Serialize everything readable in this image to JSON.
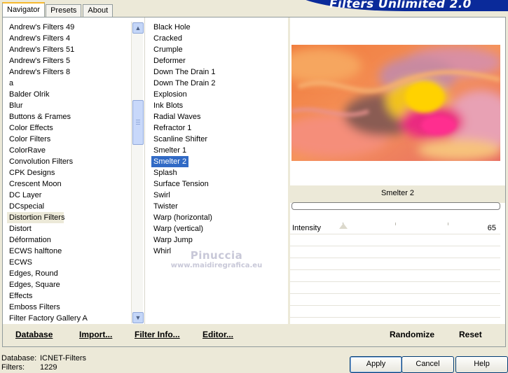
{
  "header": {
    "tabs": [
      {
        "label": "Navigator"
      },
      {
        "label": "Presets"
      },
      {
        "label": "About"
      }
    ],
    "brand": "Filters Unlimited 2.0"
  },
  "categories": {
    "items": [
      "Andrew's Filters 49",
      "Andrew's Filters 4",
      "Andrew's Filters 51",
      "Andrew's Filters 5",
      "Andrew's Filters 8",
      "a",
      "Balder Olrik",
      "Blur",
      "Buttons & Frames",
      "Color Effects",
      "Color Filters",
      "ColorRave",
      "Convolution Filters",
      "CPK Designs",
      "Crescent Moon",
      "DC Layer",
      "DCspecial",
      "Distortion Filters",
      "Distort",
      "Déformation",
      "ECWS halftone",
      "ECWS",
      "Edges, Round",
      "Edges, Square",
      "Effects",
      "Emboss Filters",
      "Filter Factory Gallery A"
    ],
    "highlighted": "Distortion Filters"
  },
  "filters": {
    "items": [
      "Black Hole",
      "Cracked",
      "Crumple",
      "Deformer",
      "Down The Drain 1",
      "Down The Drain 2",
      "Explosion",
      "Ink Blots",
      "Radial Waves",
      "Refractor 1",
      "Scanline Shifter",
      "Smelter 1",
      "Smelter 2",
      "Splash",
      "Surface Tension",
      "Swirl",
      "Twister",
      "Warp (horizontal)",
      "Warp (vertical)",
      "Warp Jump",
      "Whirl"
    ],
    "selected": "Smelter 2"
  },
  "preview": {
    "filter_name": "Smelter 2",
    "params": [
      {
        "label": "Intensity",
        "value": "65"
      }
    ]
  },
  "watermark": {
    "line1": "Pinuccia",
    "line2": "www.maidiregrafica.eu"
  },
  "toolbar": {
    "database": "Database",
    "import": "Import...",
    "filter_info": "Filter Info...",
    "editor": "Editor...",
    "randomize": "Randomize",
    "reset": "Reset"
  },
  "status": {
    "database_label": "Database:",
    "database_value": "ICNET-Filters",
    "filters_label": "Filters:",
    "filters_value": "1229"
  },
  "dialog": {
    "apply": "Apply",
    "cancel": "Cancel",
    "help": "Help"
  },
  "colors": {
    "selection": "#316ac5",
    "brand": "#0a2a9a",
    "panel": "#ece9d8"
  }
}
